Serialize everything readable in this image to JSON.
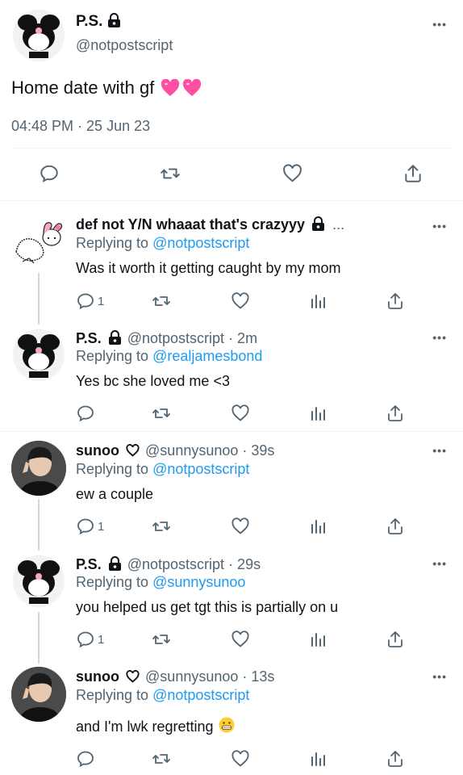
{
  "main_tweet": {
    "display_name": "P.S.",
    "handle": "@notpostscript",
    "text": "Home date with gf",
    "timestamp": "04:48 PM · 25 Jun 23"
  },
  "replies": [
    {
      "display_name": "def not Y/N whaaat that's crazyyy",
      "trailing": "...",
      "replying_prefix": "Replying to ",
      "replying_to": "@notpostscript",
      "text": "Was it worth it getting caught by my mom",
      "reply_count": "1"
    },
    {
      "display_name": "P.S.",
      "meta": "@notpostscript · 2m",
      "replying_prefix": "Replying to ",
      "replying_to": "@realjamesbond",
      "text": "Yes bc she loved me <3",
      "reply_count": ""
    },
    {
      "display_name": "sunoo",
      "meta": "@sunnysunoo · 39s",
      "replying_prefix": "Replying to ",
      "replying_to": "@notpostscript",
      "text": "ew a couple",
      "reply_count": "1"
    },
    {
      "display_name": "P.S.",
      "meta": "@notpostscript · 29s",
      "replying_prefix": "Replying to ",
      "replying_to": "@sunnysunoo",
      "text": "you helped us get tgt this is partially on u",
      "reply_count": "1"
    },
    {
      "display_name": "sunoo",
      "meta": "@sunnysunoo · 13s",
      "replying_prefix": "Replying to ",
      "replying_to": "@notpostscript",
      "text": "and I'm lwk regretting",
      "reply_count": ""
    }
  ],
  "more_label": "•••",
  "colors": {
    "link": "#1d9bf0",
    "gray": "#536471",
    "heart_emoji": "#ff4fa3"
  }
}
